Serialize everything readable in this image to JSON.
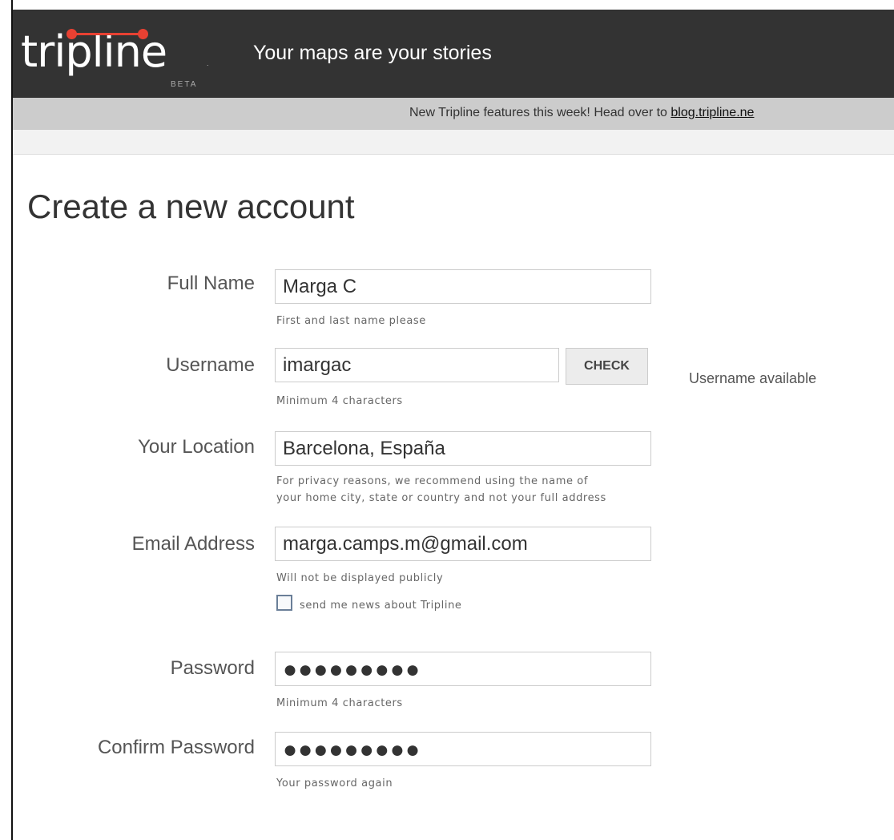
{
  "header": {
    "logo_text": "tripline",
    "logo_tm": ".",
    "logo_badge": "BETA",
    "tagline": "Your maps are your stories"
  },
  "notice": {
    "text": "New Tripline features this week! Head over to ",
    "link_text": "blog.tripline.ne"
  },
  "page_title": "Create a new account",
  "form": {
    "full_name": {
      "label": "Full Name",
      "value": "Marga C",
      "hint": "First and last name please"
    },
    "username": {
      "label": "Username",
      "value": "imargac",
      "hint": "Minimum 4 characters",
      "check_button": "CHECK",
      "status": "Username available"
    },
    "location": {
      "label": "Your Location",
      "value": "Barcelona, España",
      "hint_line1": "For privacy reasons, we recommend using the name of",
      "hint_line2": "your home city, state or country and not your full address"
    },
    "email": {
      "label": "Email Address",
      "value": "marga.camps.m@gmail.com",
      "hint": "Will not be displayed publicly",
      "newsletter_label": "send me news about Tripline",
      "newsletter_checked": false
    },
    "password": {
      "label": "Password",
      "masked_value": "●●●●●●●●●",
      "hint": "Minimum 4 characters"
    },
    "confirm_password": {
      "label": "Confirm Password",
      "masked_value": "●●●●●●●●●",
      "hint": "Your password again"
    }
  },
  "colors": {
    "header_bg": "#333333",
    "brand_accent": "#e84132",
    "notice_bg": "#cccccc"
  }
}
